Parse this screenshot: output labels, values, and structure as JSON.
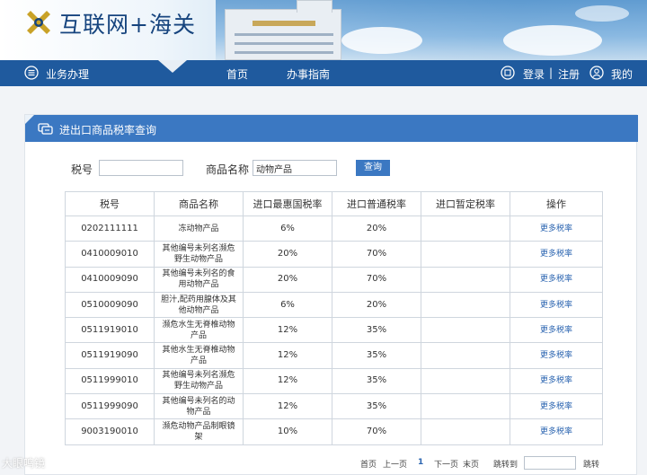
{
  "header": {
    "site_title": "互联网+海关"
  },
  "nav": {
    "business": "业务办理",
    "home": "首页",
    "guide": "办事指南",
    "login": "登录",
    "separator": "|",
    "register": "注册",
    "mine": "我的"
  },
  "panel": {
    "title": "进出口商品税率查询"
  },
  "search": {
    "tax_label": "税号",
    "tax_value": "",
    "name_label": "商品名称",
    "name_value": "动物产品",
    "button": "查询"
  },
  "table": {
    "headers": [
      "税号",
      "商品名称",
      "进口最惠国税率",
      "进口普通税率",
      "进口暂定税率",
      "操作"
    ],
    "rows": [
      {
        "code": "0202111111",
        "name": "冻动物产品",
        "mfn": "6%",
        "general": "20%",
        "provisional": "",
        "action": "更多税率"
      },
      {
        "code": "0410009010",
        "name": "其他编号未列名濒危野生动物产品",
        "mfn": "20%",
        "general": "70%",
        "provisional": "",
        "action": "更多税率"
      },
      {
        "code": "0410009090",
        "name": "其他编号未列名的食用动物产品",
        "mfn": "20%",
        "general": "70%",
        "provisional": "",
        "action": "更多税率"
      },
      {
        "code": "0510009090",
        "name": "胆汁,配药用腺体及其他动物产品",
        "mfn": "6%",
        "general": "20%",
        "provisional": "",
        "action": "更多税率"
      },
      {
        "code": "0511919010",
        "name": "濒危水生无脊椎动物产品",
        "mfn": "12%",
        "general": "35%",
        "provisional": "",
        "action": "更多税率"
      },
      {
        "code": "0511919090",
        "name": "其他水生无脊椎动物产品",
        "mfn": "12%",
        "general": "35%",
        "provisional": "",
        "action": "更多税率"
      },
      {
        "code": "0511999010",
        "name": "其他编号未列名濒危野生动物产品",
        "mfn": "12%",
        "general": "35%",
        "provisional": "",
        "action": "更多税率"
      },
      {
        "code": "0511999090",
        "name": "其他编号未列名的动物产品",
        "mfn": "12%",
        "general": "35%",
        "provisional": "",
        "action": "更多税率"
      },
      {
        "code": "9003190010",
        "name": "濒危动物产品制眼镜架",
        "mfn": "10%",
        "general": "70%",
        "provisional": "",
        "action": "更多税率"
      }
    ]
  },
  "pager": {
    "first": "首页",
    "prev": "上一页",
    "current": "1",
    "next": "下一页",
    "last": "末页",
    "jump_label": "跳转到",
    "jump_button": "跳转"
  },
  "watermark": "大眼鸣镜",
  "colors": {
    "nav": "#1f5a9e",
    "accent": "#3b78c2",
    "link": "#2a64b0"
  }
}
